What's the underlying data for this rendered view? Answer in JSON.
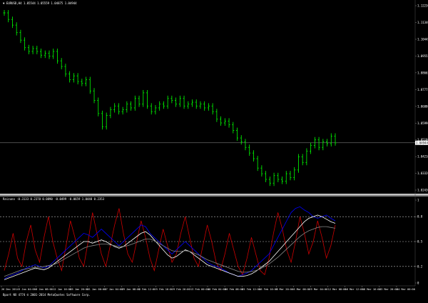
{
  "window": {
    "main_title": "▼ EURUSD,H4  1.05544 1.05559 1.04875 1.04944",
    "indicator_title": "Raizuno -0.3133 0.2378 0.0890 -0.0499 -0.0659 1.0448 0.2353",
    "footer": "Bpart NX 4774 © 2001-2014 MetaQuotes Software Corp."
  },
  "colors": {
    "background": "#000000",
    "price_candle": "#00ff00",
    "separator": "#ffffff",
    "level_line": "#bbbbbb",
    "osc_red": "#cc0000",
    "osc_blue": "#0000ff",
    "osc_white": "#ffffff",
    "osc_gray": "#888888"
  },
  "chart_data": [
    {
      "type": "candlestick",
      "title": "EURUSD,H4",
      "current_price": "1.04944",
      "price_axis_labels": [
        "1.12230",
        "1.11340",
        "1.10445",
        "1.09555",
        "1.08665",
        "1.07775",
        "1.06880",
        "1.05990",
        "1.05100",
        "1.04944",
        "1.04210",
        "1.03320",
        "1.02430"
      ],
      "ylim": [
        1.0243,
        1.1223
      ],
      "x_axis_labels": [
        "26 Dec 2014",
        "5 Jan 04:00",
        "8 Jan 08:00",
        "12 Jan 16:00",
        "15 Jan 20:00",
        "21 Jan 00:00",
        "27 Jan 04:00",
        "29 Jan 08:00",
        "2 Feb 12:00",
        "5 Feb 16:00",
        "9 Feb 20:00",
        "13 Feb 00:00",
        "18 Feb 04:00",
        "20 Feb 08:00",
        "25 Feb 12:00",
        "26 Feb 16:00",
        "3 Mar 20:00",
        "6 Mar 00:00",
        "9 Mar 04:00",
        "12 Mar 08:00",
        "16 Mar 12:00",
        "18 Mar 16:00",
        "23 Mar 20:00",
        "24 Mar 00:00"
      ],
      "close": [
        1.1185,
        1.115,
        1.112,
        1.108,
        1.104,
        1.1,
        1.098,
        1.0995,
        1.098,
        1.096,
        1.097,
        1.0955,
        1.098,
        1.093,
        1.09,
        1.086,
        1.083,
        1.085,
        1.082,
        1.081,
        1.083,
        1.077,
        1.072,
        1.065,
        1.058,
        1.064,
        1.067,
        1.069,
        1.066,
        1.067,
        1.07,
        1.068,
        1.073,
        1.07,
        1.076,
        1.069,
        1.066,
        1.068,
        1.07,
        1.069,
        1.073,
        1.072,
        1.07,
        1.073,
        1.069,
        1.07,
        1.071,
        1.069,
        1.07,
        1.068,
        1.069,
        1.066,
        1.062,
        1.06,
        1.061,
        1.059,
        1.056,
        1.052,
        1.05,
        1.047,
        1.044,
        1.041,
        1.036,
        1.033,
        1.03,
        1.028,
        1.032,
        1.03,
        1.029,
        1.033,
        1.031,
        1.035,
        1.042,
        1.039,
        1.045,
        1.048,
        1.051,
        1.047,
        1.05,
        1.049,
        1.053,
        1.0494
      ]
    },
    {
      "type": "line",
      "title": "Raizuno",
      "y_axis_labels": [
        "1",
        "0.8",
        "0.5",
        "0.2",
        "0"
      ],
      "levels": [
        0.8,
        0.5,
        0.2
      ],
      "ylim": [
        0,
        1
      ],
      "series": [
        {
          "color": "red",
          "values": [
            0.15,
            0.35,
            0.6,
            0.3,
            0.2,
            0.5,
            0.7,
            0.4,
            0.25,
            0.55,
            0.8,
            0.5,
            0.3,
            0.15,
            0.45,
            0.75,
            0.55,
            0.3,
            0.2,
            0.5,
            0.85,
            0.6,
            0.35,
            0.2,
            0.45,
            0.7,
            0.9,
            0.6,
            0.35,
            0.25,
            0.5,
            0.75,
            0.55,
            0.3,
            0.15,
            0.4,
            0.65,
            0.45,
            0.25,
            0.35,
            0.6,
            0.8,
            0.55,
            0.3,
            0.2,
            0.45,
            0.7,
            0.5,
            0.25,
            0.15,
            0.35,
            0.6,
            0.4,
            0.2,
            0.1,
            0.3,
            0.55,
            0.35,
            0.15,
            0.1,
            0.3,
            0.6,
            0.85,
            0.65,
            0.4,
            0.25,
            0.5,
            0.8,
            0.6,
            0.35,
            0.5,
            0.75,
            0.55,
            0.3,
            0.45,
            0.7
          ]
        },
        {
          "color": "blue",
          "values": [
            0.05,
            0.08,
            0.1,
            0.12,
            0.15,
            0.18,
            0.2,
            0.22,
            0.2,
            0.18,
            0.2,
            0.25,
            0.3,
            0.35,
            0.4,
            0.45,
            0.5,
            0.55,
            0.6,
            0.58,
            0.55,
            0.6,
            0.65,
            0.6,
            0.55,
            0.5,
            0.45,
            0.5,
            0.55,
            0.6,
            0.65,
            0.7,
            0.68,
            0.6,
            0.55,
            0.5,
            0.45,
            0.4,
            0.35,
            0.4,
            0.45,
            0.5,
            0.45,
            0.4,
            0.35,
            0.3,
            0.25,
            0.22,
            0.2,
            0.18,
            0.15,
            0.12,
            0.1,
            0.08,
            0.1,
            0.12,
            0.15,
            0.2,
            0.25,
            0.3,
            0.35,
            0.45,
            0.55,
            0.65,
            0.75,
            0.85,
            0.9,
            0.92,
            0.88,
            0.85,
            0.8,
            0.78,
            0.8,
            0.82,
            0.78,
            0.75
          ]
        },
        {
          "color": "white",
          "values": [
            0.04,
            0.06,
            0.08,
            0.1,
            0.12,
            0.14,
            0.16,
            0.18,
            0.17,
            0.16,
            0.18,
            0.22,
            0.26,
            0.3,
            0.34,
            0.38,
            0.42,
            0.46,
            0.5,
            0.5,
            0.48,
            0.5,
            0.52,
            0.5,
            0.47,
            0.44,
            0.42,
            0.44,
            0.48,
            0.52,
            0.56,
            0.6,
            0.62,
            0.58,
            0.52,
            0.46,
            0.4,
            0.34,
            0.3,
            0.32,
            0.36,
            0.4,
            0.38,
            0.34,
            0.3,
            0.26,
            0.22,
            0.2,
            0.18,
            0.16,
            0.14,
            0.12,
            0.1,
            0.08,
            0.08,
            0.09,
            0.11,
            0.14,
            0.18,
            0.22,
            0.26,
            0.32,
            0.38,
            0.44,
            0.5,
            0.56,
            0.62,
            0.68,
            0.74,
            0.78,
            0.8,
            0.82,
            0.8,
            0.77,
            0.74,
            0.72
          ]
        },
        {
          "color": "gray",
          "values": [
            0.08,
            0.1,
            0.12,
            0.14,
            0.16,
            0.17,
            0.18,
            0.19,
            0.19,
            0.2,
            0.21,
            0.22,
            0.24,
            0.27,
            0.3,
            0.33,
            0.36,
            0.39,
            0.42,
            0.44,
            0.45,
            0.46,
            0.47,
            0.47,
            0.46,
            0.45,
            0.44,
            0.44,
            0.45,
            0.47,
            0.49,
            0.51,
            0.53,
            0.53,
            0.51,
            0.48,
            0.45,
            0.42,
            0.39,
            0.38,
            0.38,
            0.39,
            0.38,
            0.36,
            0.34,
            0.31,
            0.28,
            0.26,
            0.24,
            0.22,
            0.2,
            0.18,
            0.16,
            0.14,
            0.13,
            0.13,
            0.14,
            0.15,
            0.17,
            0.2,
            0.23,
            0.27,
            0.31,
            0.36,
            0.41,
            0.46,
            0.51,
            0.56,
            0.6,
            0.63,
            0.65,
            0.67,
            0.68,
            0.68,
            0.67,
            0.66
          ]
        }
      ]
    }
  ]
}
